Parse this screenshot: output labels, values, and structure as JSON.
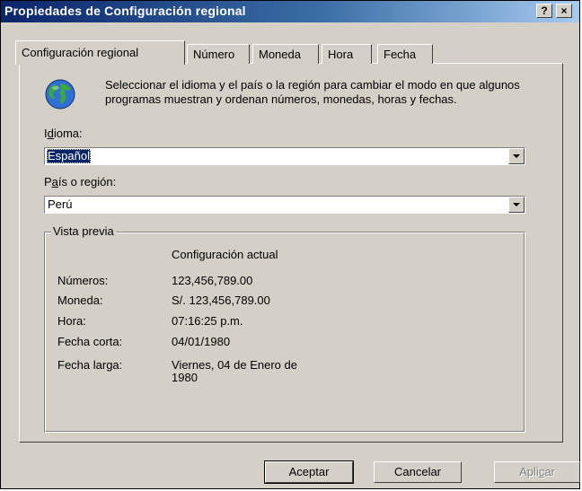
{
  "window": {
    "title": "Propiedades de Configuración regional",
    "help_glyph": "?",
    "close_glyph": "×"
  },
  "tabs": [
    {
      "label": "Configuración regional",
      "active": true
    },
    {
      "label": "Número"
    },
    {
      "label": "Moneda"
    },
    {
      "label": "Hora"
    },
    {
      "label": "Fecha"
    }
  ],
  "intro": {
    "text": "Seleccionar el idioma y el país o la región para cambiar el modo en que algunos programas muestran y ordenan números, monedas, horas y fechas.",
    "icon": "globe-icon"
  },
  "idioma": {
    "label_pre": "I",
    "label_u": "d",
    "label_post": "ioma:",
    "value": "Español"
  },
  "region": {
    "label_pre": "P",
    "label_u": "a",
    "label_post": "ís o región:",
    "value": "Perú"
  },
  "preview": {
    "legend": "Vista previa",
    "header": "Configuración actual",
    "rows": [
      {
        "key": "Números:",
        "value": "123,456,789.00"
      },
      {
        "key": "Moneda:",
        "value": "S/. 123,456,789.00"
      },
      {
        "key": "Hora:",
        "value": "07:16:25 p.m."
      },
      {
        "key": "Fecha corta:",
        "value": "04/01/1980"
      },
      {
        "key": "Fecha larga:",
        "value": "Viernes, 04 de Enero de",
        "value2": "1980"
      }
    ]
  },
  "buttons": {
    "ok": "Aceptar",
    "cancel": "Cancelar",
    "apply_pre": "Apli",
    "apply_u": "c",
    "apply_post": "ar"
  }
}
